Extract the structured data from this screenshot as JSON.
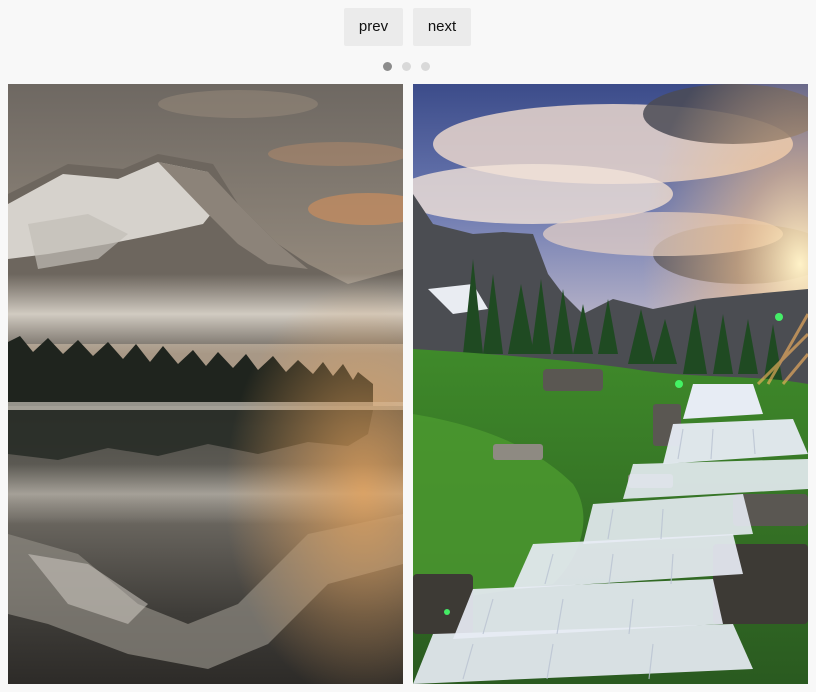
{
  "carousel": {
    "prev_label": "prev",
    "next_label": "next",
    "dots": [
      {
        "active": true
      },
      {
        "active": false
      },
      {
        "active": false
      }
    ],
    "slides": [
      {
        "subject": "mountain-lake-reflection-photo"
      },
      {
        "subject": "waterfall-landscape-photo"
      }
    ]
  }
}
